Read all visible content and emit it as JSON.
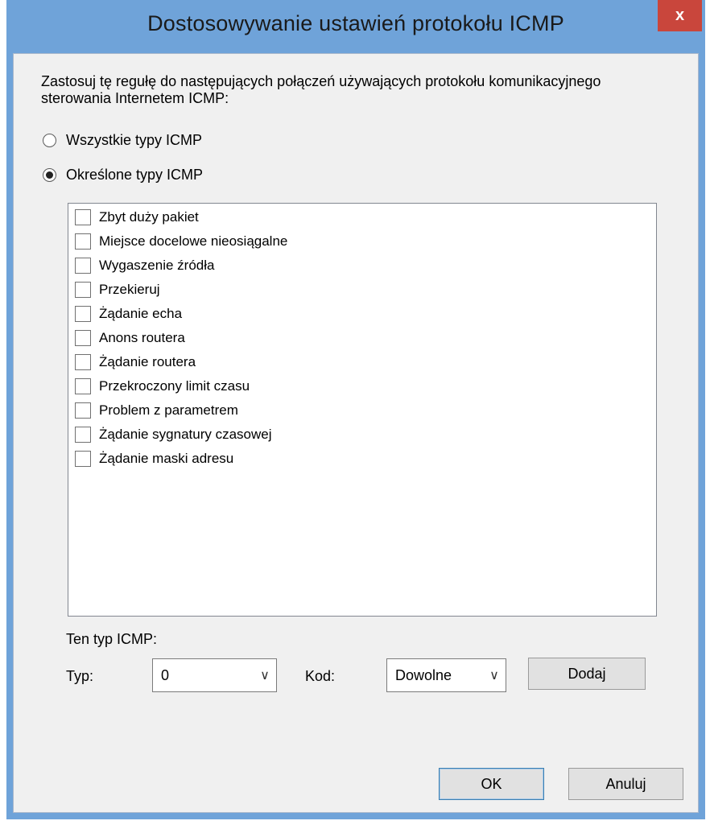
{
  "window": {
    "title": "Dostosowywanie ustawień protokołu ICMP",
    "close_label": "x"
  },
  "intro_text": "Zastosuj tę regułę do następujących połączeń używających protokołu komunikacyjnego sterowania Internetem ICMP:",
  "radios": {
    "all": {
      "label": "Wszystkie typy ICMP",
      "checked": false
    },
    "specific": {
      "label": "Określone typy ICMP",
      "checked": true
    }
  },
  "icmp_types": [
    "Zbyt duży pakiet",
    "Miejsce docelowe nieosiągalne",
    "Wygaszenie źródła",
    "Przekieruj",
    "Żądanie echa",
    "Anons routera",
    "Żądanie routera",
    "Przekroczony limit czasu",
    "Problem z parametrem",
    "Żądanie sygnatury czasowej",
    "Żądanie maski adresu"
  ],
  "custom": {
    "section_label": "Ten typ ICMP:",
    "type_label": "Typ:",
    "type_value": "0",
    "code_label": "Kod:",
    "code_value": "Dowolne",
    "add_label": "Dodaj"
  },
  "buttons": {
    "ok": "OK",
    "cancel": "Anuluj"
  }
}
